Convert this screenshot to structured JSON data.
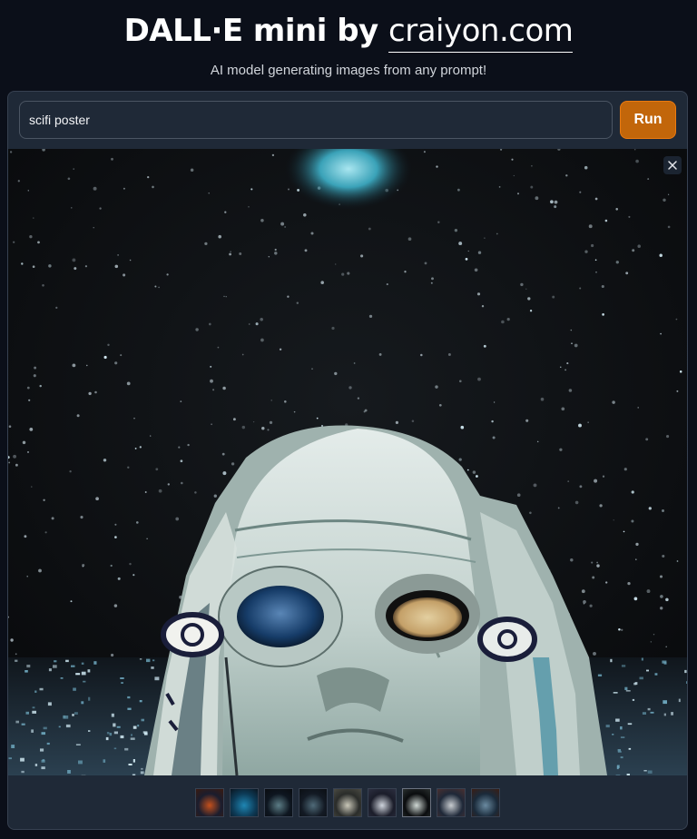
{
  "header": {
    "title_main": "DALL·E mini by",
    "title_link": "craiyon.com",
    "subtitle": "AI model generating images from any prompt!"
  },
  "prompt": {
    "value": "scifi poster",
    "run_label": "Run"
  },
  "gallery": {
    "selected_index": 6,
    "thumbnails": [
      {
        "name": "thumb-1",
        "colors": [
          "#1a1d2e",
          "#c4501c",
          "#3a1a10"
        ]
      },
      {
        "name": "thumb-2",
        "colors": [
          "#0d3b57",
          "#1f86b3",
          "#0a1520"
        ]
      },
      {
        "name": "thumb-3",
        "colors": [
          "#0e1620",
          "#5c7d86",
          "#090c10"
        ]
      },
      {
        "name": "thumb-4",
        "colors": [
          "#131a24",
          "#4f6a78",
          "#0b0f14"
        ]
      },
      {
        "name": "thumb-5",
        "colors": [
          "#2a2c2a",
          "#c9c7b8",
          "#4a4a42"
        ]
      },
      {
        "name": "thumb-6",
        "colors": [
          "#1b1d2a",
          "#cfd4dc",
          "#2c2f40"
        ]
      },
      {
        "name": "thumb-7",
        "colors": [
          "#0a0c0e",
          "#cfd8d4",
          "#2a3030"
        ]
      },
      {
        "name": "thumb-8",
        "colors": [
          "#1e2838",
          "#c8ccd0",
          "#4a3030"
        ]
      },
      {
        "name": "thumb-9",
        "colors": [
          "#1a2a3a",
          "#6a8aa0",
          "#3a1e14"
        ]
      }
    ]
  },
  "colors": {
    "background": "#0b0f19",
    "panel": "#1f2937",
    "accent": "#c2660a"
  }
}
